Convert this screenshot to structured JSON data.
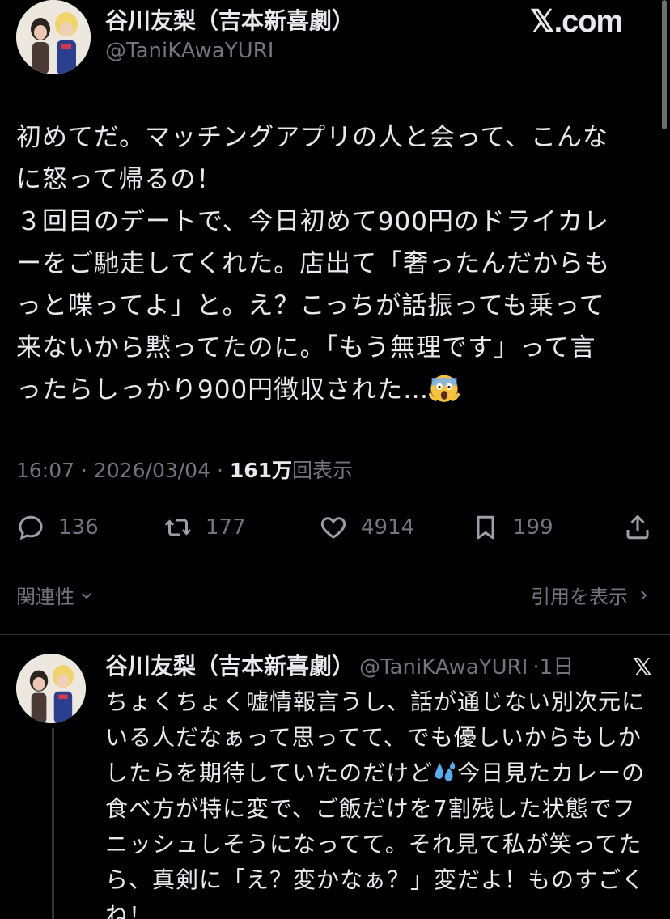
{
  "brand": {
    "label": "𝕏.com"
  },
  "main_tweet": {
    "author_name": "谷川友梨（吉本新喜劇）",
    "author_handle": "@TaniKAwaYURI",
    "text_lines": [
      "初めてだ。マッチングアプリの人と会って、こんな",
      "に怒って帰るの！",
      "３回目のデートで、今日初めて900円のドライカレ",
      "ーをご馳走してくれた。店出て「奢ったんだからも",
      "っと喋ってよ」と。え？こっちが話振っても乗って",
      "来ないから黙ってたのに。「もう無理です」って言",
      "ったらしっかり900円徴収された…"
    ],
    "emoji": "face-screaming-in-fear",
    "time": "16:07",
    "date": "2026/03/04",
    "views_count": "161万",
    "views_label": "回表示",
    "separator": "·",
    "replies": "136",
    "retweets": "177",
    "likes": "4914",
    "bookmarks": "199"
  },
  "links": {
    "related": "関連性",
    "view_quotes": "引用を表示"
  },
  "reply_tweet": {
    "author_name": "谷川友梨（吉本新喜劇）",
    "author_handle": "@TaniKAwaYURI",
    "age": "·1日",
    "x_label": "𝕏",
    "text_before_emoji": "ちょくちょく嘘情報言うし、話が通じない別次元にいる人だなぁって思ってて、でも優しいからもしかしたらを期待していたのだけど",
    "emoji": "sweat-droplets",
    "text_after_emoji": "今日見たカレーの食べ方が特に変で、ご飯だけを7割残した状態でフニッシュしそうになってて。それ見て私が笑ってたら、真剣に「え？変かなぁ？」変だよ！ものすごくね！"
  },
  "colors": {
    "background": "#000000",
    "text": "#e7e9ea",
    "secondary": "#71767b",
    "divider": "#2f3336"
  }
}
